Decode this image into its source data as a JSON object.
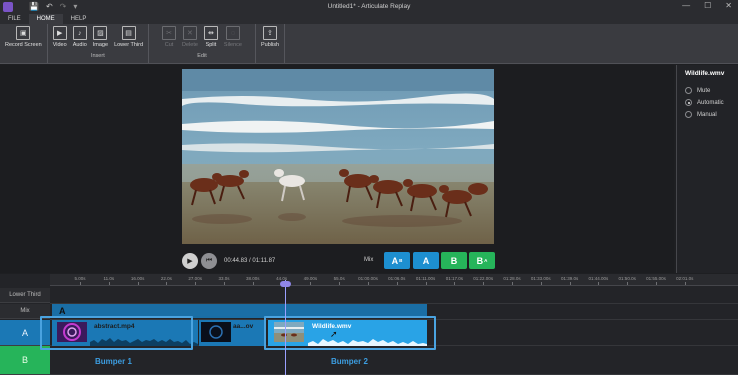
{
  "titlebar": {
    "title": "Untitled1* - Articulate Replay",
    "qat": [
      "💾",
      "↶",
      "↷",
      "▾"
    ],
    "window_buttons": [
      "—",
      "☐",
      "✕"
    ]
  },
  "tabs": [
    "FILE",
    "HOME",
    "HELP"
  ],
  "ribbon": {
    "record_screen": "Record Screen",
    "insert": {
      "label": "Insert",
      "items": [
        "Video",
        "Audio",
        "Image",
        "Lower Third"
      ]
    },
    "edit": {
      "label": "Edit",
      "items": [
        "Cut",
        "Delete",
        "Split",
        "Silence"
      ]
    },
    "publish": "Publish"
  },
  "player": {
    "timecode": "00:44.83 / 01:11.87",
    "mix_label": "Mix",
    "mix_buttons": [
      {
        "label": "A",
        "sub": "B",
        "color": "#1d8fd0"
      },
      {
        "label": "A",
        "sub": "",
        "color": "#1d8fd0"
      },
      {
        "label": "B",
        "sub": "",
        "color": "#26b45a"
      },
      {
        "label": "B",
        "sub": "A",
        "color": "#26b45a"
      }
    ]
  },
  "properties": {
    "title": "Wildlife.wmv",
    "options": [
      "Mute",
      "Automatic",
      "Manual"
    ],
    "selected": "Automatic"
  },
  "timeline": {
    "ticks": [
      "5.00s",
      "11.0s",
      "16.00s",
      "22.0s",
      "27.00s",
      "33.0s",
      "38.00s",
      "44.0s",
      "49.00s",
      "55.0s",
      "01:00.00s",
      "01:06.0s",
      "01:11.00s",
      "01:17.0s",
      "01:22.00s",
      "01:28.0s",
      "01:33.00s",
      "01:39.0s",
      "01:44.00s",
      "01:50.0s",
      "01:55.00s",
      "02:01.0s"
    ],
    "tracks": {
      "lower_third": "Lower Third",
      "mix": "Mix",
      "a": "A",
      "b": "B"
    },
    "mix_bar_label": "A",
    "clip1": "abstract.mp4",
    "clip_mid": "aa...ov",
    "clip2": "Wildlife.wmv",
    "bumper1": "Bumper 1",
    "bumper2": "Bumper 2"
  },
  "colors": {
    "track_a": "#1b78b5",
    "track_b": "#26b45a",
    "selected_clip": "#29a3e6",
    "accent": "#4aa3e0"
  }
}
